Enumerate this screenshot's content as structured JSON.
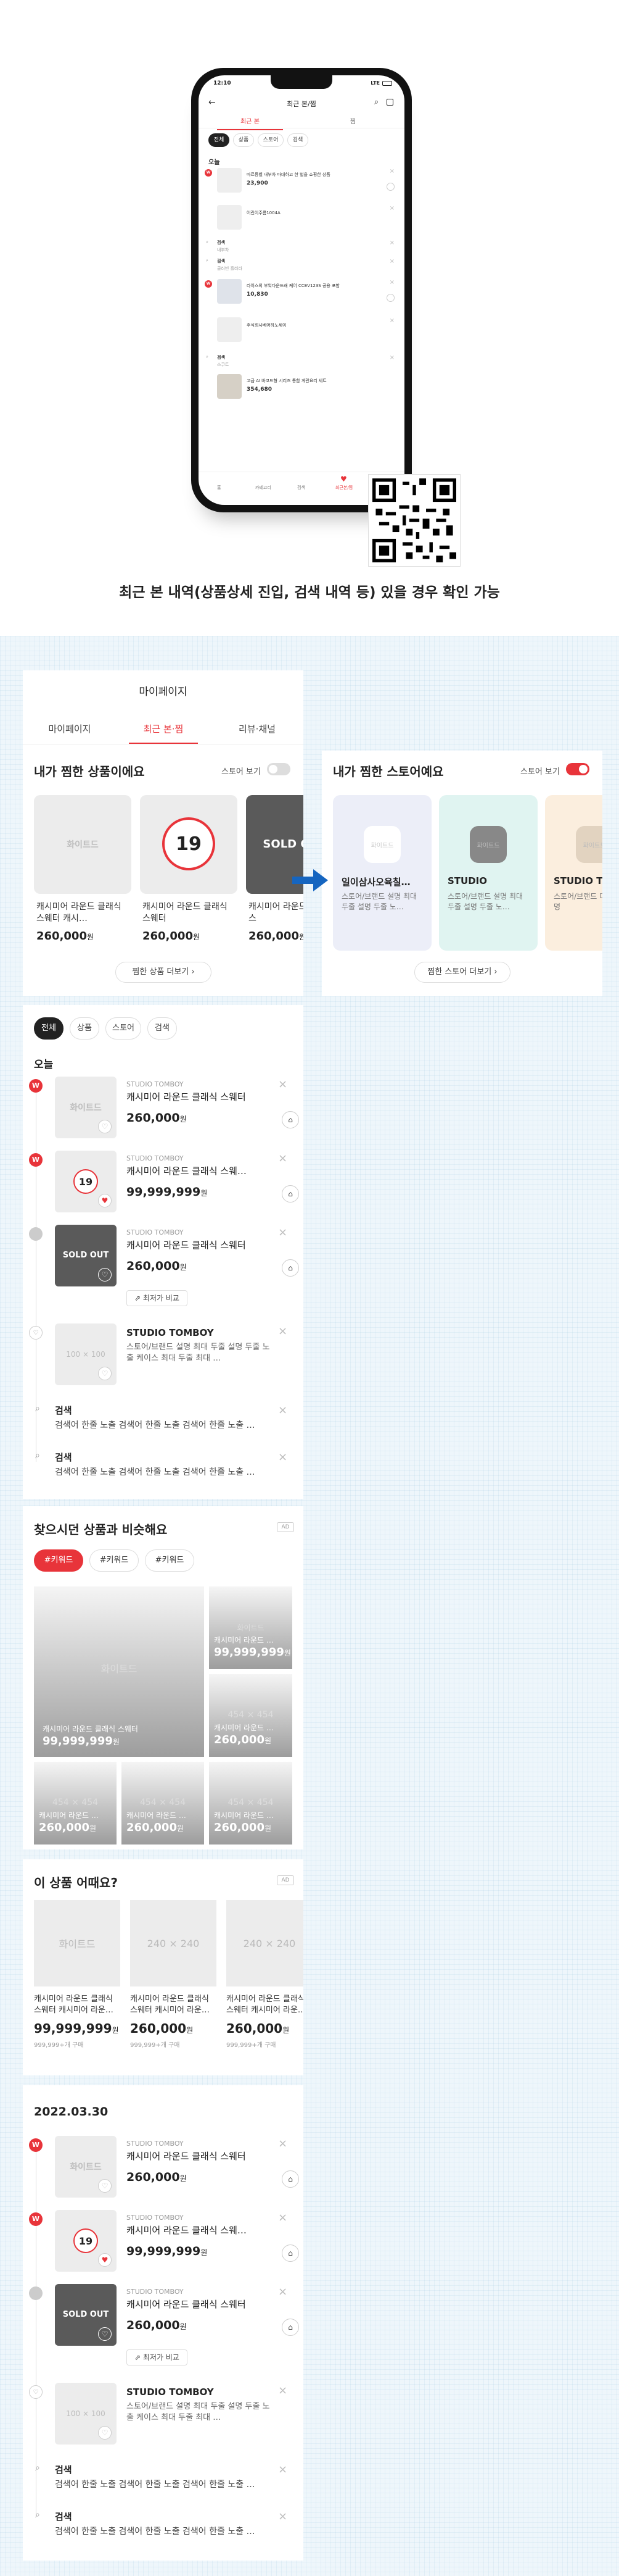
{
  "phone": {
    "time": "12:10",
    "network": "LTE",
    "title": "최근 본/찜",
    "tabs": [
      "최근 본",
      "찜"
    ],
    "chips": [
      "전체",
      "상품",
      "스토어",
      "검색"
    ],
    "today": "오늘",
    "rows": [
      {
        "brand": "",
        "name": "따르릉벨 내부차 마대하고 한 벌을 쇼핑한 상품",
        "price": "23,900",
        "unit": "원"
      },
      {
        "name": "어린이주름1004A"
      },
      {
        "title": "검색",
        "text": "내부차"
      },
      {
        "title": "검색",
        "text": "클러빈 흘러라"
      },
      {
        "brand": "",
        "name": "라이스의 부엌다운드래 케어 CCEV123S 공용 포함",
        "price": "10,830",
        "unit": "원"
      },
      {
        "name": "주식회사베어하노세이"
      },
      {
        "title": "검색",
        "text": "스쿠트"
      },
      {
        "name": "고급 AI 바코드형 시리즈 통합 계란요리 세트",
        "price": "354,680",
        "unit": "원"
      }
    ],
    "nav": [
      "홈",
      "카테고리",
      "검색",
      "최근본/찜"
    ]
  },
  "caption": "최근 본 내역(상품상세 진입, 검색 내역 등) 있을 경우 확인 가능",
  "mypage": {
    "title": "마이페이지",
    "tabs": [
      "마이페이지",
      "최근 본·찜",
      "리뷰·채널"
    ]
  },
  "wish": {
    "title": "내가 찜한 상품이에요",
    "toggle_label": "스토어 보기",
    "watermark": "화이트드",
    "sold": "SOLD OUT",
    "limit": "19",
    "cards": [
      {
        "name": "캐시미어 라운드 클래식 스웨터 캐시…",
        "price": "260,000",
        "unit": "원"
      },
      {
        "name": "캐시미어 라운드 클래식 스웨터",
        "price": "260,000",
        "unit": "원"
      },
      {
        "name": "캐시미어 라운드 클래식 스",
        "price": "260,000",
        "unit": "원"
      }
    ],
    "more": "찜한 상품 더보기"
  },
  "stores": {
    "title": "내가 찜한 스토어예요",
    "toggle_label": "스토어 보기",
    "watermark": "화이트드",
    "cards": [
      {
        "name": "일이삼사오육칠…",
        "desc": "스토어/브랜드 설명 최대 두줄 설명 두줄 노…"
      },
      {
        "name": "STUDIO",
        "desc": "스토어/브랜드 설명 최대 두줄 설명 두줄 노…"
      },
      {
        "name": "STUDIO TO",
        "desc": "스토어/브랜드 대 두줄 설명"
      }
    ],
    "more": "찜한 스토어 더보기"
  },
  "recent": {
    "chips": [
      "전체",
      "상품",
      "스토어",
      "검색"
    ],
    "group1": "오늘",
    "group2": "2022.03.30",
    "items": [
      {
        "badge": "W",
        "brand": "STUDIO TOMBOY",
        "name": "캐시미어 라운드 클래식 스웨터",
        "price": "260,000",
        "unit": "원"
      },
      {
        "badge": "W",
        "brand": "STUDIO TOMBOY",
        "name": "캐시미어 라운드 클래식 스웨…",
        "price": "99,999,999",
        "unit": "원"
      },
      {
        "badge": "",
        "brand": "STUDIO TOMBOY",
        "name": "캐시미어 라운드 클래식 스웨터",
        "price": "260,000",
        "unit": "원",
        "compare": "최저가 비교"
      },
      {
        "store": "STUDIO TOMBOY",
        "desc": "스토어/브랜드 설명 최대 두줄 설명 두줄 노출 케이스 최대 두줄 최대 …",
        "thumb": "100 × 100"
      },
      {
        "title": "검색",
        "text": "검색어 한줄 노출 검색어 한줄 노출 검색어 한줄 노출 …"
      },
      {
        "title": "검색",
        "text": "검색어 한줄 노출 검색어 한줄 노출 검색어 한줄 노출 …"
      }
    ]
  },
  "similar": {
    "title": "찾으시던 상품과 비슷해요",
    "ad": "AD",
    "keywords": [
      "#키워드",
      "#키워드",
      "#키워드"
    ],
    "watermark": "화이트드",
    "size": "454 × 454",
    "tiles": [
      {
        "name": "캐시미어 라운드 클래식 스웨터",
        "price": "99,999,999",
        "unit": "원"
      },
      {
        "name": "캐시미어 라운드 …",
        "price": "99,999,999",
        "unit": "원"
      },
      {
        "name": "캐시미어 라운드 …",
        "price": "260,000",
        "unit": "원"
      },
      {
        "name": "캐시미어 라운드 …",
        "price": "260,000",
        "unit": "원"
      },
      {
        "name": "캐시미어 라운드 …",
        "price": "260,000",
        "unit": "원"
      },
      {
        "name": "캐시미어 라운드 …",
        "price": "260,000",
        "unit": "원"
      }
    ]
  },
  "howabout": {
    "title": "이 상품 어때요?",
    "ad": "AD",
    "watermark": "화이트드",
    "size": "240 × 240",
    "cards": [
      {
        "name": "캐시미어 라운드 클래식 스웨터 캐시미어 라운…",
        "price": "99,999,999",
        "unit": "원",
        "sub": "999,999+개 구매"
      },
      {
        "name": "캐시미어 라운드 클래식 스웨터 캐시미어 라운…",
        "price": "260,000",
        "unit": "원",
        "sub": "999,999+개 구매"
      },
      {
        "name": "캐시미어 라운드 클래식 스웨터 캐시미어 라운…",
        "price": "260,000",
        "unit": "원",
        "sub": "999,999+개 구매"
      }
    ]
  },
  "colors": {
    "accent": "#e8343a",
    "dark": "#222222",
    "border": "#dddddd"
  }
}
